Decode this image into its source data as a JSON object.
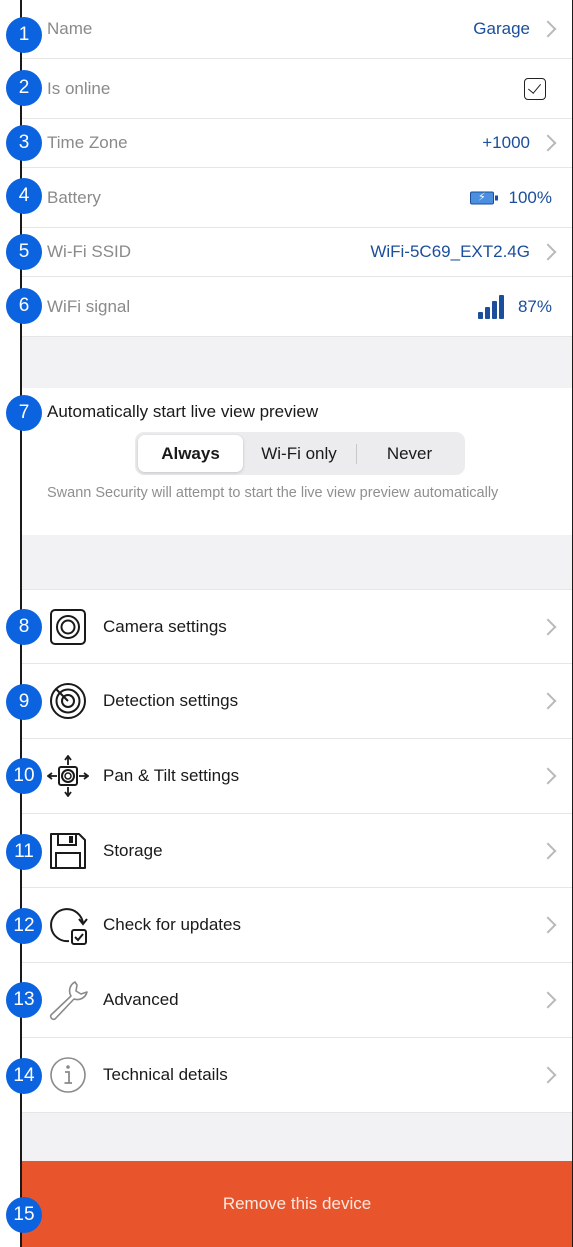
{
  "info": {
    "name": {
      "label": "Name",
      "value": "Garage"
    },
    "online": {
      "label": "Is online",
      "checked": true
    },
    "timezone": {
      "label": "Time Zone",
      "value": "+1000"
    },
    "battery": {
      "label": "Battery",
      "value": "100%"
    },
    "ssid": {
      "label": "Wi-Fi SSID",
      "value": "WiFi-5C69_EXT2.4G"
    },
    "signal": {
      "label": "WiFi signal",
      "value": "87%"
    }
  },
  "liveview": {
    "title": "Automatically start live view preview",
    "options": [
      "Always",
      "Wi-Fi only",
      "Never"
    ],
    "selected": "Always",
    "note": "Swann Security will attempt to start the live view preview automatically"
  },
  "menu": {
    "camera": "Camera settings",
    "detection": "Detection settings",
    "pantilt": "Pan & Tilt settings",
    "storage": "Storage",
    "updates": "Check for updates",
    "advanced": "Advanced",
    "technical": "Technical details"
  },
  "remove_label": "Remove this device",
  "badges": [
    "1",
    "2",
    "3",
    "4",
    "5",
    "6",
    "7",
    "8",
    "9",
    "10",
    "11",
    "12",
    "13",
    "14",
    "15"
  ],
  "colors": {
    "accent": "#1b4e9b",
    "badge": "#0b63e0",
    "danger": "#e8552c"
  }
}
